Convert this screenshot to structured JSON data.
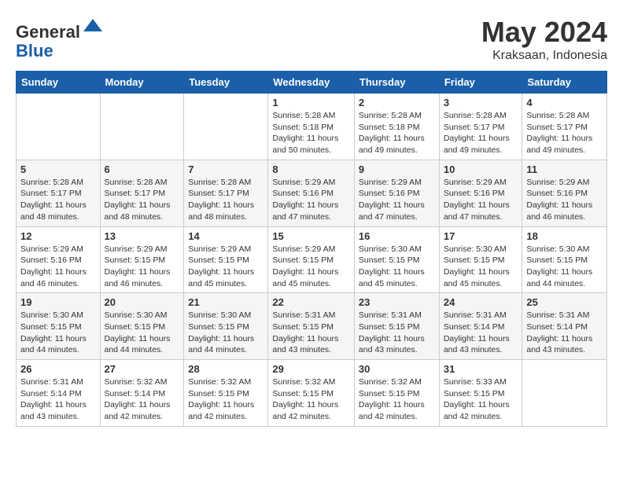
{
  "header": {
    "logo_line1": "General",
    "logo_line2": "Blue",
    "title": "May 2024",
    "location": "Kraksaan, Indonesia"
  },
  "weekdays": [
    "Sunday",
    "Monday",
    "Tuesday",
    "Wednesday",
    "Thursday",
    "Friday",
    "Saturday"
  ],
  "weeks": [
    [
      {
        "day": "",
        "info": ""
      },
      {
        "day": "",
        "info": ""
      },
      {
        "day": "",
        "info": ""
      },
      {
        "day": "1",
        "info": "Sunrise: 5:28 AM\nSunset: 5:18 PM\nDaylight: 11 hours\nand 50 minutes."
      },
      {
        "day": "2",
        "info": "Sunrise: 5:28 AM\nSunset: 5:18 PM\nDaylight: 11 hours\nand 49 minutes."
      },
      {
        "day": "3",
        "info": "Sunrise: 5:28 AM\nSunset: 5:17 PM\nDaylight: 11 hours\nand 49 minutes."
      },
      {
        "day": "4",
        "info": "Sunrise: 5:28 AM\nSunset: 5:17 PM\nDaylight: 11 hours\nand 49 minutes."
      }
    ],
    [
      {
        "day": "5",
        "info": "Sunrise: 5:28 AM\nSunset: 5:17 PM\nDaylight: 11 hours\nand 48 minutes."
      },
      {
        "day": "6",
        "info": "Sunrise: 5:28 AM\nSunset: 5:17 PM\nDaylight: 11 hours\nand 48 minutes."
      },
      {
        "day": "7",
        "info": "Sunrise: 5:28 AM\nSunset: 5:17 PM\nDaylight: 11 hours\nand 48 minutes."
      },
      {
        "day": "8",
        "info": "Sunrise: 5:29 AM\nSunset: 5:16 PM\nDaylight: 11 hours\nand 47 minutes."
      },
      {
        "day": "9",
        "info": "Sunrise: 5:29 AM\nSunset: 5:16 PM\nDaylight: 11 hours\nand 47 minutes."
      },
      {
        "day": "10",
        "info": "Sunrise: 5:29 AM\nSunset: 5:16 PM\nDaylight: 11 hours\nand 47 minutes."
      },
      {
        "day": "11",
        "info": "Sunrise: 5:29 AM\nSunset: 5:16 PM\nDaylight: 11 hours\nand 46 minutes."
      }
    ],
    [
      {
        "day": "12",
        "info": "Sunrise: 5:29 AM\nSunset: 5:16 PM\nDaylight: 11 hours\nand 46 minutes."
      },
      {
        "day": "13",
        "info": "Sunrise: 5:29 AM\nSunset: 5:15 PM\nDaylight: 11 hours\nand 46 minutes."
      },
      {
        "day": "14",
        "info": "Sunrise: 5:29 AM\nSunset: 5:15 PM\nDaylight: 11 hours\nand 45 minutes."
      },
      {
        "day": "15",
        "info": "Sunrise: 5:29 AM\nSunset: 5:15 PM\nDaylight: 11 hours\nand 45 minutes."
      },
      {
        "day": "16",
        "info": "Sunrise: 5:30 AM\nSunset: 5:15 PM\nDaylight: 11 hours\nand 45 minutes."
      },
      {
        "day": "17",
        "info": "Sunrise: 5:30 AM\nSunset: 5:15 PM\nDaylight: 11 hours\nand 45 minutes."
      },
      {
        "day": "18",
        "info": "Sunrise: 5:30 AM\nSunset: 5:15 PM\nDaylight: 11 hours\nand 44 minutes."
      }
    ],
    [
      {
        "day": "19",
        "info": "Sunrise: 5:30 AM\nSunset: 5:15 PM\nDaylight: 11 hours\nand 44 minutes."
      },
      {
        "day": "20",
        "info": "Sunrise: 5:30 AM\nSunset: 5:15 PM\nDaylight: 11 hours\nand 44 minutes."
      },
      {
        "day": "21",
        "info": "Sunrise: 5:30 AM\nSunset: 5:15 PM\nDaylight: 11 hours\nand 44 minutes."
      },
      {
        "day": "22",
        "info": "Sunrise: 5:31 AM\nSunset: 5:15 PM\nDaylight: 11 hours\nand 43 minutes."
      },
      {
        "day": "23",
        "info": "Sunrise: 5:31 AM\nSunset: 5:15 PM\nDaylight: 11 hours\nand 43 minutes."
      },
      {
        "day": "24",
        "info": "Sunrise: 5:31 AM\nSunset: 5:14 PM\nDaylight: 11 hours\nand 43 minutes."
      },
      {
        "day": "25",
        "info": "Sunrise: 5:31 AM\nSunset: 5:14 PM\nDaylight: 11 hours\nand 43 minutes."
      }
    ],
    [
      {
        "day": "26",
        "info": "Sunrise: 5:31 AM\nSunset: 5:14 PM\nDaylight: 11 hours\nand 43 minutes."
      },
      {
        "day": "27",
        "info": "Sunrise: 5:32 AM\nSunset: 5:14 PM\nDaylight: 11 hours\nand 42 minutes."
      },
      {
        "day": "28",
        "info": "Sunrise: 5:32 AM\nSunset: 5:15 PM\nDaylight: 11 hours\nand 42 minutes."
      },
      {
        "day": "29",
        "info": "Sunrise: 5:32 AM\nSunset: 5:15 PM\nDaylight: 11 hours\nand 42 minutes."
      },
      {
        "day": "30",
        "info": "Sunrise: 5:32 AM\nSunset: 5:15 PM\nDaylight: 11 hours\nand 42 minutes."
      },
      {
        "day": "31",
        "info": "Sunrise: 5:33 AM\nSunset: 5:15 PM\nDaylight: 11 hours\nand 42 minutes."
      },
      {
        "day": "",
        "info": ""
      }
    ]
  ]
}
